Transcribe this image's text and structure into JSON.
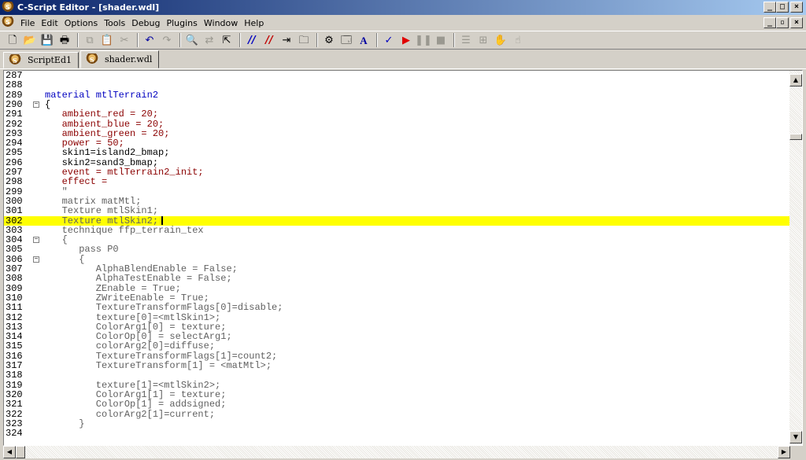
{
  "window": {
    "title": "C-Script Editor - [shader.wdl]",
    "buttons": {
      "minimize": "_",
      "restore": "□",
      "close": "×"
    }
  },
  "menu": {
    "items": [
      "File",
      "Edit",
      "Options",
      "Tools",
      "Debug",
      "Plugins",
      "Window",
      "Help"
    ],
    "mdi_buttons": {
      "minimize": "_",
      "restore": "▫",
      "close": "×"
    }
  },
  "toolbar": {
    "icons": [
      "new-icon",
      "open-icon",
      "save-icon",
      "print-icon",
      "copy-icon",
      "paste-icon",
      "cut-icon",
      "undo-icon",
      "redo-icon",
      "find-icon",
      "replace-icon",
      "goto-icon",
      "comment-icon",
      "uncomment-icon",
      "indent-icon",
      "bookmark-icon",
      "tools-icon",
      "properties-icon",
      "font-icon",
      "spellcheck-icon",
      "run-icon",
      "pause-icon",
      "stop-icon",
      "toggle-icon",
      "breakpoint-icon",
      "hand-icon",
      "hand2-icon"
    ],
    "run_color": "#e00000"
  },
  "tabs": [
    {
      "label": "ScriptEd1",
      "active": false
    },
    {
      "label": "shader.wdl",
      "active": true
    }
  ],
  "editor": {
    "current_line": 302,
    "lines": [
      {
        "n": "287",
        "t": ""
      },
      {
        "n": "288",
        "t": ""
      },
      {
        "n": "289",
        "t": "material mtlTerrain2"
      },
      {
        "n": "290",
        "t": "{"
      },
      {
        "n": "291",
        "t": "   ambient_red = 20;"
      },
      {
        "n": "292",
        "t": "   ambient_blue = 20;"
      },
      {
        "n": "293",
        "t": "   ambient_green = 20;"
      },
      {
        "n": "294",
        "t": "   power = 50;"
      },
      {
        "n": "295",
        "t": "   skin1=island2_bmap;"
      },
      {
        "n": "296",
        "t": "   skin2=sand3_bmap;"
      },
      {
        "n": "297",
        "t": "   event = mtlTerrain2_init;"
      },
      {
        "n": "298",
        "t": "   effect ="
      },
      {
        "n": "299",
        "t": "   \""
      },
      {
        "n": "300",
        "t": "   matrix matMtl;"
      },
      {
        "n": "301",
        "t": "   Texture mtlSkin1;"
      },
      {
        "n": "302",
        "t": "   Texture mtlSkin2;"
      },
      {
        "n": "303",
        "t": "   technique ffp_terrain_tex"
      },
      {
        "n": "304",
        "t": "   {"
      },
      {
        "n": "305",
        "t": "      pass P0"
      },
      {
        "n": "306",
        "t": "      {"
      },
      {
        "n": "307",
        "t": "         AlphaBlendEnable = False;"
      },
      {
        "n": "308",
        "t": "         AlphaTestEnable = False;"
      },
      {
        "n": "309",
        "t": "         ZEnable = True;"
      },
      {
        "n": "310",
        "t": "         ZWriteEnable = True;"
      },
      {
        "n": "311",
        "t": "         TextureTransformFlags[0]=disable;"
      },
      {
        "n": "312",
        "t": "         texture[0]=<mtlSkin1>;"
      },
      {
        "n": "313",
        "t": "         ColorArg1[0] = texture;"
      },
      {
        "n": "314",
        "t": "         ColorOp[0] = selectArg1;"
      },
      {
        "n": "315",
        "t": "         colorArg2[0]=diffuse;"
      },
      {
        "n": "316",
        "t": "         TextureTransformFlags[1]=count2;"
      },
      {
        "n": "317",
        "t": "         TextureTransform[1] = <matMtl>;"
      },
      {
        "n": "318",
        "t": ""
      },
      {
        "n": "319",
        "t": "         texture[1]=<mtlSkin2>;"
      },
      {
        "n": "320",
        "t": "         ColorArg1[1] = texture;"
      },
      {
        "n": "321",
        "t": "         ColorOp[1] = addsigned;"
      },
      {
        "n": "322",
        "t": "         colorArg2[1]=current;"
      },
      {
        "n": "323",
        "t": "      }"
      },
      {
        "n": "324",
        "t": ""
      }
    ]
  },
  "colors": {
    "titlebar_start": "#0a246a",
    "titlebar_end": "#a6caf0",
    "current_line_highlight": "#ffff00",
    "keyword": "#0000c0",
    "property": "#8b0000",
    "number": "#a000a0",
    "effect_string": "#606060"
  }
}
